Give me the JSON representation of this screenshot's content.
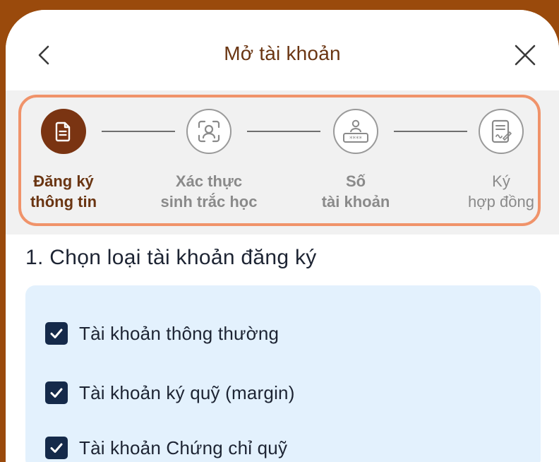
{
  "header": {
    "title": "Mở tài khoản",
    "back_icon": "chevron-left-icon",
    "close_icon": "close-icon"
  },
  "stepper": {
    "steps": [
      {
        "line1": "Đăng ký",
        "line2": "thông tin",
        "icon": "document-icon",
        "state": "active"
      },
      {
        "line1": "Xác thực",
        "line2": "sinh trắc học",
        "icon": "face-scan-icon",
        "state": "inactive"
      },
      {
        "line1": "Số",
        "line2": "tài khoản",
        "icon": "account-number-icon",
        "state": "inactive"
      },
      {
        "line1": "Ký",
        "line2": "hợp đồng",
        "icon": "contract-sign-icon",
        "state": "inactive"
      }
    ]
  },
  "section": {
    "title": "1. Chọn loại tài khoản đăng ký",
    "options": [
      {
        "label": "Tài khoản thông thường",
        "checked": true
      },
      {
        "label": "Tài khoản ký quỹ (margin)",
        "checked": true
      },
      {
        "label": "Tài khoản Chứng chỉ quỹ",
        "checked": true
      }
    ]
  },
  "colors": {
    "brand_brown": "#7a3412",
    "title_brown": "#6a3512",
    "highlight_orange": "#f0936a",
    "checkbox_navy": "#152a4a",
    "panel_blue": "#e3f1fd",
    "frame_background": "#9a4a0c"
  }
}
